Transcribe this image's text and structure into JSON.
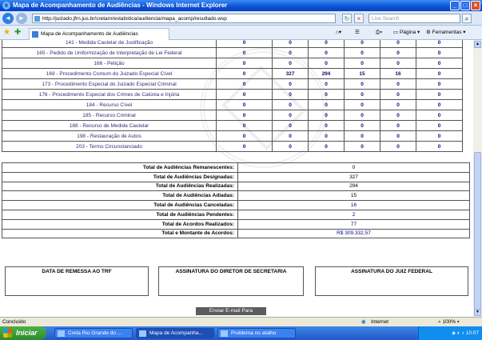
{
  "window": {
    "title": "Mapa de Acompanhamento de Audiências - Windows Internet Explorer",
    "controls": [
      "_",
      "□",
      "×"
    ]
  },
  "toolbar": {
    "back": "◄",
    "forward": "►",
    "url": "http://juizado.jfrn.jus.br/cretarn/estatistica/audiencia/mapa_acomp/resultado.wsp",
    "refresh": "↻",
    "stop": "×",
    "search_placeholder": "Live Search",
    "search_go": "⌕"
  },
  "tabs": {
    "active": "Mapa de Acompanhamento de Audiências",
    "page_menu": "Página",
    "tools_menu": "Ferramentas"
  },
  "procedures": [
    {
      "name": "141 - Medida Cautelar de Justificação",
      "values": [
        "0",
        "0",
        "0",
        "0",
        "0",
        "0"
      ]
    },
    {
      "name": "165 - Pedido de Uniformização de Interpretação de Lei Federal",
      "values": [
        "0",
        "0",
        "0",
        "0",
        "0",
        "0"
      ]
    },
    {
      "name": "166 - Petição",
      "values": [
        "0",
        "0",
        "0",
        "0",
        "0",
        "0"
      ]
    },
    {
      "name": "169 - Procedimento Comum do Juizado Especial Cível",
      "values": [
        "0",
        "327",
        "294",
        "15",
        "16",
        "0"
      ]
    },
    {
      "name": "173 - Procedimento Especial do Juizado Especial Criminal",
      "values": [
        "0",
        "0",
        "0",
        "0",
        "0",
        "0"
      ]
    },
    {
      "name": "176 - Procedimento Especial dos Crimes de Calúnia e Injúria",
      "values": [
        "0",
        "0",
        "0",
        "0",
        "0",
        "0"
      ]
    },
    {
      "name": "184 - Recurso Cível",
      "values": [
        "0",
        "0",
        "0",
        "0",
        "0",
        "0"
      ]
    },
    {
      "name": "185 - Recurso Criminal",
      "values": [
        "0",
        "0",
        "0",
        "0",
        "0",
        "0"
      ]
    },
    {
      "name": "188 - Recurso de Medida Cautelar",
      "values": [
        "0",
        "0",
        "0",
        "0",
        "0",
        "0"
      ]
    },
    {
      "name": "198 - Restauração de Autos",
      "values": [
        "0",
        "0",
        "0",
        "0",
        "0",
        "0"
      ]
    },
    {
      "name": "203 - Termo Circunstanciado",
      "values": [
        "0",
        "0",
        "0",
        "0",
        "0",
        "0"
      ]
    }
  ],
  "summary": [
    {
      "label": "Total de Audiências Remanescentes:",
      "value": "0"
    },
    {
      "label": "Total de Audiências Designadas:",
      "value": "327"
    },
    {
      "label": "Total de Audiências Realizadas:",
      "value": "294"
    },
    {
      "label": "Total de Audiências Adiadas:",
      "value": "15"
    },
    {
      "label": "Total de Audiências Canceladas:",
      "value": "16"
    },
    {
      "label": "Total de Audiências Pendentes:",
      "value": "2"
    },
    {
      "label": "Total de Acordos Realizados:",
      "value": "77"
    },
    {
      "label": "Total e Montante de Acordos:",
      "value": "R$ 309.332,57"
    }
  ],
  "signatures": {
    "trf": "DATA DE REMESSA AO TRF",
    "director": "ASSINATURA DO DIRETOR DE SECRETARIA",
    "judge": "ASSINATURA DO JUIZ FEDERAL"
  },
  "email_button": "Enviar E-mail Para",
  "status": {
    "text": "Concluído",
    "zone": "Internet",
    "zoom": "100%"
  },
  "taskbar": {
    "start": "Iniciar",
    "tasks": [
      "Creta Rio Grande do ...",
      "Mapa de Acompanha...",
      "Problema no atalho"
    ],
    "clock": "10:07"
  },
  "colors": {
    "link": "#3a2a78",
    "value": "#0d0d70",
    "accent": "#00008b"
  }
}
